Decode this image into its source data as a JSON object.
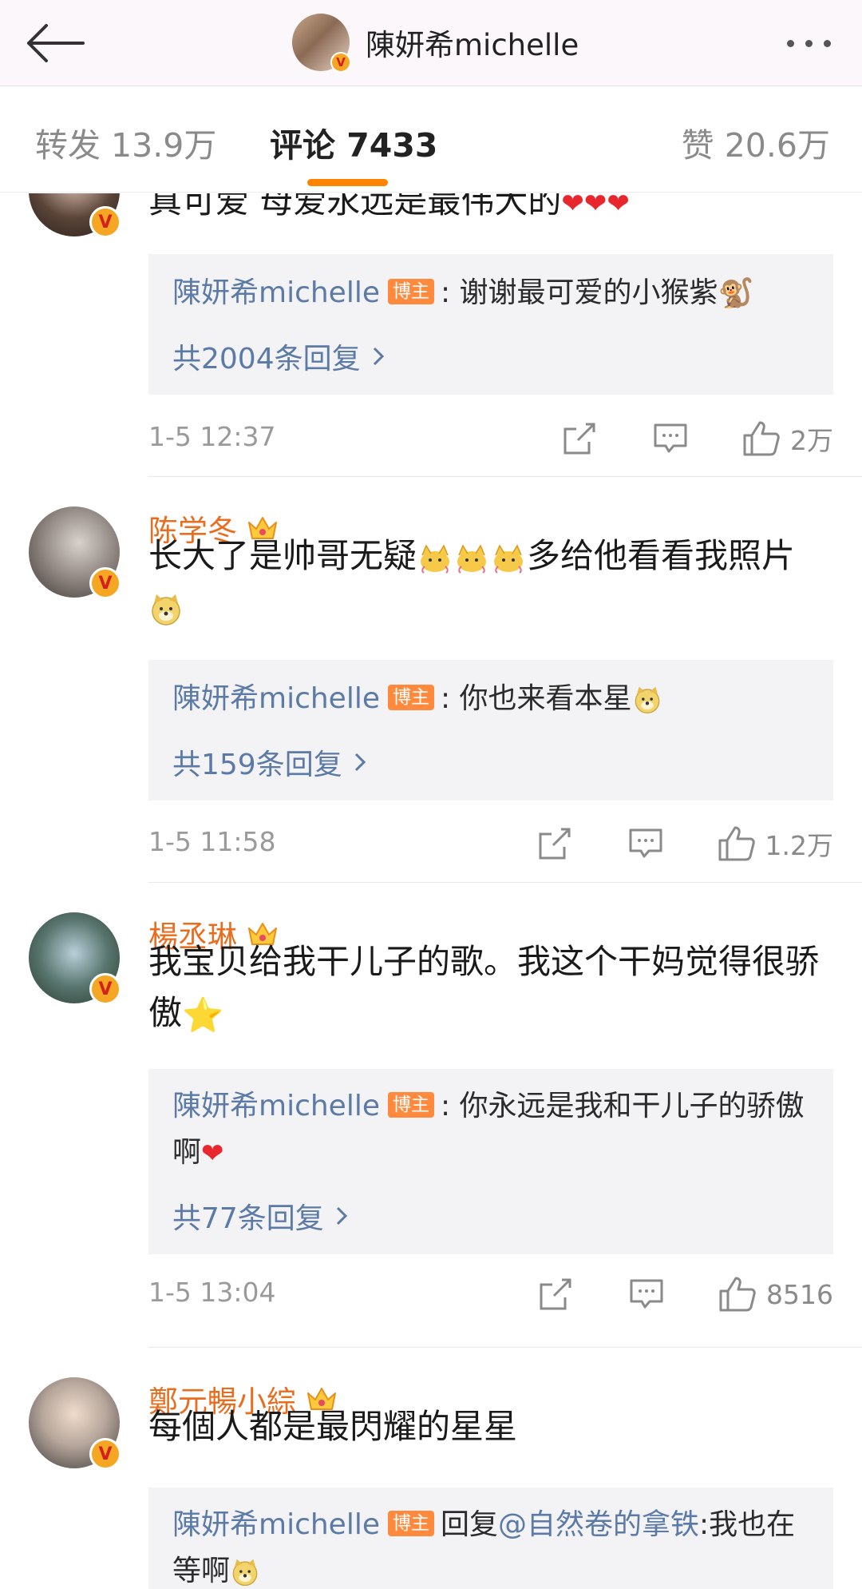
{
  "header": {
    "title": "陳妍希michelle",
    "verified_badge": "V"
  },
  "tabs": {
    "forward": "转发 13.9万",
    "comment": "评论 7433",
    "like": "赞 20.6万",
    "active_color": "#ff8200"
  },
  "owner_badge": "博主",
  "comments": [
    {
      "username": "",
      "text": "真可爱 母爱永远是最伟大的",
      "text_emojis": [
        "❤",
        "❤",
        "❤"
      ],
      "reply": {
        "author": "陳妍希michelle",
        "text": ": 谢谢最可爱的小猴紫",
        "emoji": "🐒",
        "count": "共2004条回复"
      },
      "time": "1-5 12:37",
      "likes": "2万"
    },
    {
      "username": "陈学冬",
      "text_before": "长大了是帅哥无疑",
      "text_after": "多给他看看我照片",
      "reply": {
        "author": "陳妍希michelle",
        "text": ": 你也来看本星",
        "count": "共159条回复"
      },
      "time": "1-5 11:58",
      "likes": "1.2万"
    },
    {
      "username": "楊丞琳",
      "text": "我宝贝给我干儿子的歌。我这个干妈觉得很骄傲",
      "text_emoji": "⭐",
      "reply": {
        "author": "陳妍希michelle",
        "text": ": 你永远是我和干儿子的骄傲啊",
        "emoji": "❤",
        "count": "共77条回复"
      },
      "time": "1-5 13:04",
      "likes": "8516"
    },
    {
      "username": "鄭元暢小綜",
      "text": "每個人都是最閃耀的星星",
      "reply": {
        "author": "陳妍希michelle",
        "prefix": "回复",
        "mention": "@自然卷的拿铁",
        "text": ":我也在等啊"
      }
    }
  ],
  "icons": {
    "back": "arrow-left-icon",
    "more": "more-dots-icon",
    "share": "share-icon",
    "comment": "comment-icon",
    "like": "thumbs-up-icon",
    "crown": "crown-icon",
    "chevron": "chevron-right-icon"
  },
  "colors": {
    "username": "#e86d1f",
    "link_blue": "#5b7aa6",
    "owner_badge_bg": "#ff8a3d",
    "verified_badge": "#f5a623"
  }
}
